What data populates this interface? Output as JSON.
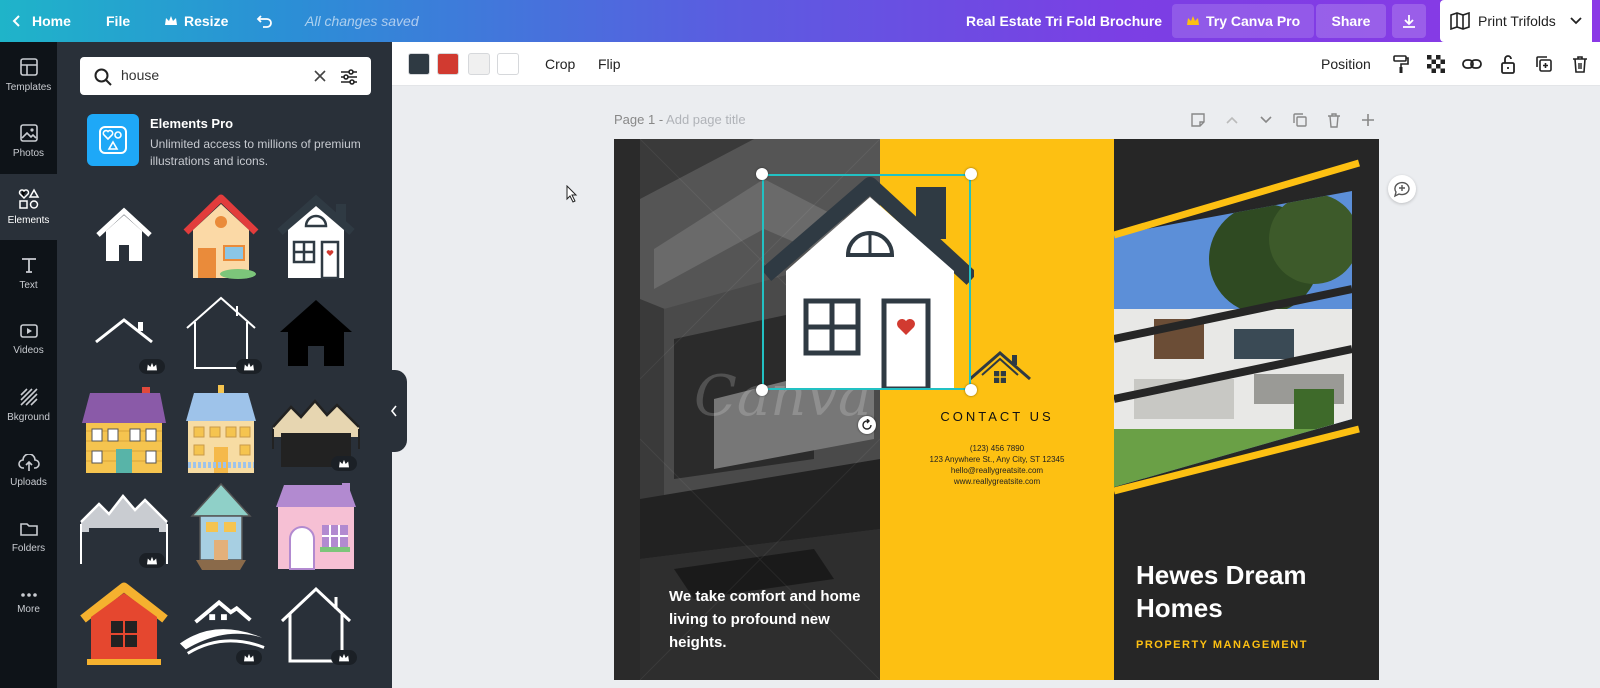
{
  "topbar": {
    "home": "Home",
    "file": "File",
    "resize": "Resize",
    "saved_status": "All changes saved",
    "document_title": "Real Estate Tri Fold Brochure",
    "try_pro": "Try Canva Pro",
    "share": "Share",
    "print": "Print Trifolds"
  },
  "rail": {
    "items": [
      {
        "label": "Templates",
        "icon": "templates-icon"
      },
      {
        "label": "Photos",
        "icon": "photos-icon"
      },
      {
        "label": "Elements",
        "icon": "elements-icon"
      },
      {
        "label": "Text",
        "icon": "text-icon"
      },
      {
        "label": "Videos",
        "icon": "videos-icon"
      },
      {
        "label": "Bkground",
        "icon": "background-icon"
      },
      {
        "label": "Uploads",
        "icon": "uploads-icon"
      },
      {
        "label": "Folders",
        "icon": "folders-icon"
      },
      {
        "label": "More",
        "icon": "more-icon"
      }
    ],
    "active": "Elements"
  },
  "panel": {
    "search_value": "house",
    "promo_title": "Elements Pro",
    "promo_desc": "Unlimited access to millions of premium illustrations and icons."
  },
  "toolbar": {
    "swatches": [
      "#2f3a43",
      "#d13a30",
      "#f0f0f0",
      "#ffffff"
    ],
    "crop": "Crop",
    "flip": "Flip",
    "position": "Position"
  },
  "canvas": {
    "page_label": "Page 1 - ",
    "page_placeholder": "Add page title"
  },
  "design": {
    "quote": "We take comfort and home living to profound new heights.",
    "contact_title": "CONTACT US",
    "phone": "(123) 456 7890",
    "address": "123 Anywhere St., Any City, ST 12345",
    "email": "hello@reallygreatsite.com",
    "website": "www.reallygreatsite.com",
    "brand": "Hewes Dream Homes",
    "brand_sub": "PROPERTY MANAGEMENT",
    "watermark": "Canva"
  },
  "colors": {
    "accent_yellow": "#fdc012",
    "panel_bg": "#293039",
    "rail_bg": "#0e1318",
    "selection": "#22c1c3"
  }
}
